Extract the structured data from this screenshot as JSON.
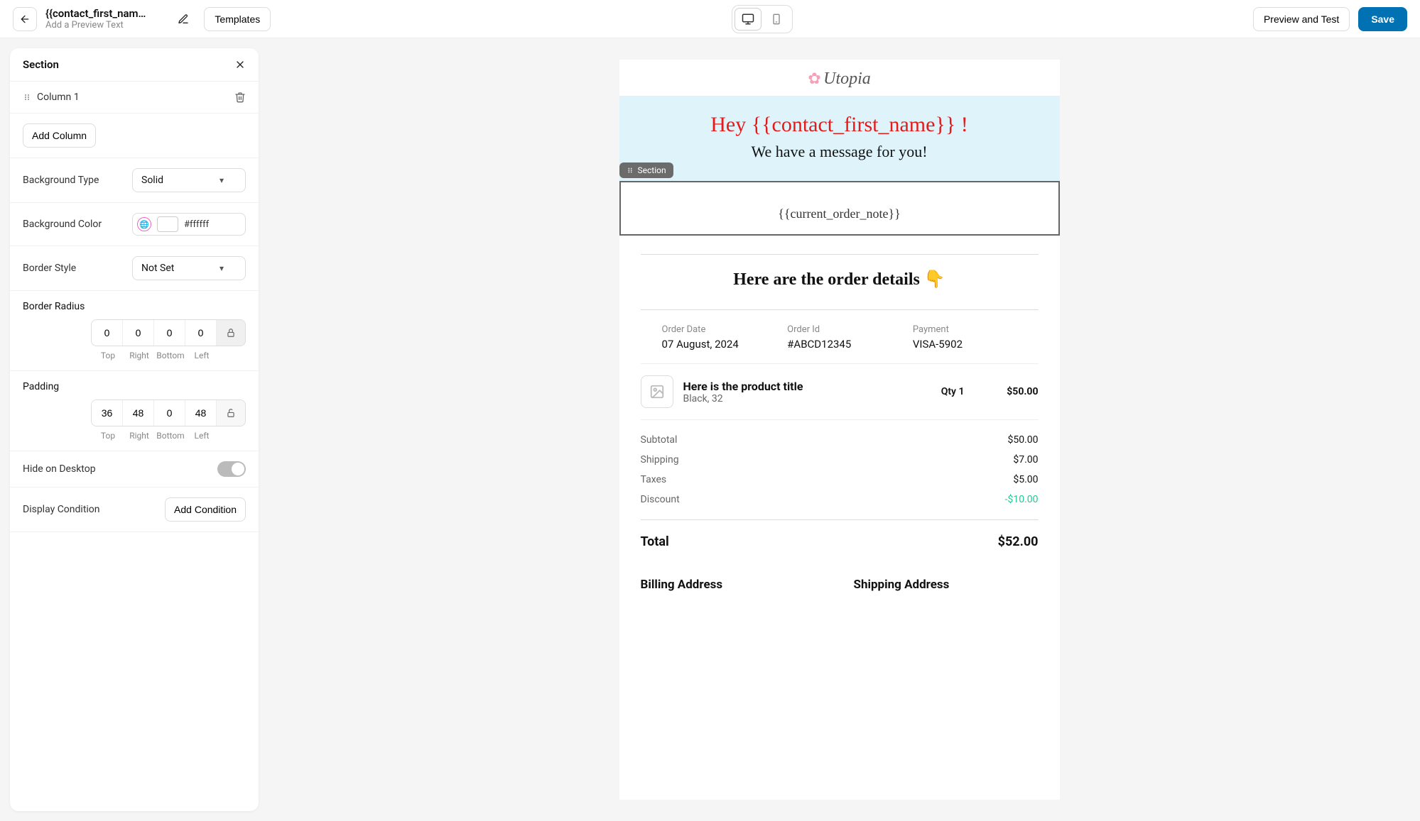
{
  "topbar": {
    "title": "{{contact_first_nam…",
    "subtitle": "Add a Preview Text",
    "templates_btn": "Templates",
    "preview_btn": "Preview and Test",
    "save_btn": "Save"
  },
  "panel": {
    "title": "Section",
    "column_label": "Column 1",
    "add_column": "Add Column",
    "bg_type_label": "Background Type",
    "bg_type_value": "Solid",
    "bg_color_label": "Background Color",
    "bg_color_value": "#ffffff",
    "border_style_label": "Border Style",
    "border_style_value": "Not Set",
    "border_radius_label": "Border Radius",
    "border_radius": {
      "top": "0",
      "right": "0",
      "bottom": "0",
      "left": "0"
    },
    "padding_label": "Padding",
    "padding": {
      "top": "36",
      "right": "48",
      "bottom": "0",
      "left": "48"
    },
    "side_labels": {
      "top": "Top",
      "right": "Right",
      "bottom": "Bottom",
      "left": "Left"
    },
    "hide_desktop_label": "Hide on Desktop",
    "display_condition_label": "Display Condition",
    "add_condition_btn": "Add Condition"
  },
  "canvas": {
    "logo": "Utopia",
    "greeting": "Hey {{contact_first_name}} !",
    "sub_greeting": "We have a message for you!",
    "section_tag": "Section",
    "order_note": "{{current_order_note}}",
    "details_heading": "Here are the order details  👇",
    "meta": {
      "order_date_label": "Order Date",
      "order_date_value": "07 August, 2024",
      "order_id_label": "Order Id",
      "order_id_value": "#ABCD12345",
      "payment_label": "Payment",
      "payment_value": "VISA-5902"
    },
    "product": {
      "title": "Here is the product title",
      "variant": "Black, 32",
      "qty": "Qty 1",
      "price": "$50.00"
    },
    "totals": {
      "subtotal_label": "Subtotal",
      "subtotal_value": "$50.00",
      "shipping_label": "Shipping",
      "shipping_value": "$7.00",
      "taxes_label": "Taxes",
      "taxes_value": "$5.00",
      "discount_label": "Discount",
      "discount_value": "-$10.00",
      "total_label": "Total",
      "total_value": "$52.00"
    },
    "billing_label": "Billing Address",
    "shipping_label": "Shipping Address"
  }
}
